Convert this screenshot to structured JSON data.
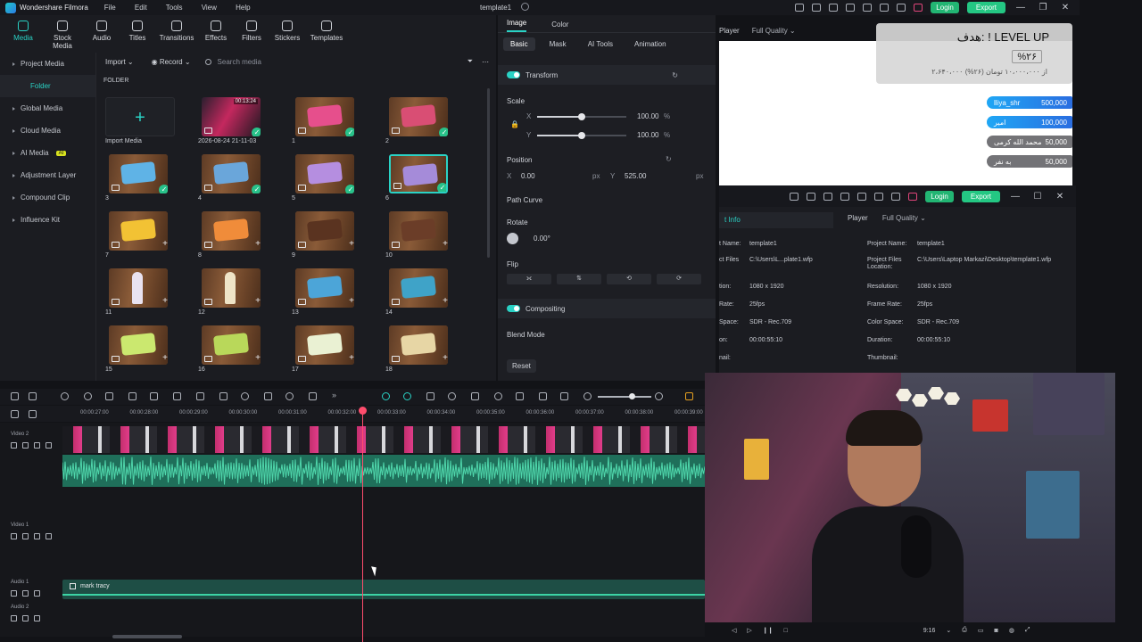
{
  "app": {
    "name": "Wondershare Filmora",
    "document_title": "template1",
    "menu": [
      "File",
      "Edit",
      "Tools",
      "View",
      "Help"
    ],
    "login_label": "Login",
    "export_label": "Export"
  },
  "media_tabs": [
    "Media",
    "Stock Media",
    "Audio",
    "Titles",
    "Transitions",
    "Effects",
    "Filters",
    "Stickers",
    "Templates"
  ],
  "sidebar": {
    "items": [
      {
        "label": "Project Media"
      },
      {
        "label": "Folder"
      },
      {
        "label": "Global Media"
      },
      {
        "label": "Cloud Media"
      },
      {
        "label": "AI Media",
        "badge": "AI"
      },
      {
        "label": "Adjustment Layer"
      },
      {
        "label": "Compound Clip"
      },
      {
        "label": "Influence Kit"
      }
    ]
  },
  "media_toolbar": {
    "import_label": "Import",
    "record_label": "Record",
    "search_placeholder": "Search media"
  },
  "folder_label": "FOLDER",
  "media_items": [
    {
      "label": "Import Media",
      "kind": "import"
    },
    {
      "label": "2026-08-24 21-11-03",
      "kind": "video",
      "duration": "00:13:24"
    },
    {
      "label": "1",
      "kind": "image",
      "color": "#e64f8c"
    },
    {
      "label": "2",
      "kind": "image",
      "color": "#d94e74"
    },
    {
      "label": "3",
      "kind": "image",
      "color": "#5fb3e6"
    },
    {
      "label": "4",
      "kind": "image",
      "color": "#6aa6da"
    },
    {
      "label": "5",
      "kind": "image",
      "color": "#b58ee0"
    },
    {
      "label": "6",
      "kind": "image",
      "color": "#a58bd9"
    },
    {
      "label": "7",
      "kind": "image",
      "color": "#f2c234"
    },
    {
      "label": "8",
      "kind": "image",
      "color": "#f08c3a"
    },
    {
      "label": "9",
      "kind": "image",
      "color": "#5a3320"
    },
    {
      "label": "10",
      "kind": "image",
      "color": "#6b3d28"
    },
    {
      "label": "11",
      "kind": "cone",
      "color": "#e9e2f0"
    },
    {
      "label": "12",
      "kind": "cone",
      "color": "#efe4c7"
    },
    {
      "label": "13",
      "kind": "image",
      "color": "#4ca5d8"
    },
    {
      "label": "14",
      "kind": "image",
      "color": "#3fa3c8"
    },
    {
      "label": "15",
      "kind": "image",
      "color": "#cbe86f"
    },
    {
      "label": "16",
      "kind": "image",
      "color": "#b9d85a"
    },
    {
      "label": "17",
      "kind": "image",
      "color": "#eaf1d3"
    },
    {
      "label": "18",
      "kind": "image",
      "color": "#e7d6a5"
    }
  ],
  "properties": {
    "tabs": [
      "Image",
      "Color"
    ],
    "sub_tabs": [
      "Basic",
      "Mask",
      "AI Tools",
      "Animation"
    ],
    "transform_label": "Transform",
    "scale_label": "Scale",
    "scale_x_label": "X",
    "scale_y_label": "Y",
    "scale_x": "100.00",
    "scale_y": "100.00",
    "scale_unit": "%",
    "scale_x_fraction": 0.5,
    "scale_y_fraction": 0.5,
    "position_label": "Position",
    "pos_x_label": "X",
    "pos_x": "0.00",
    "pos_y_label": "Y",
    "pos_y": "525.00",
    "pos_unit": "px",
    "path_curve_label": "Path Curve",
    "rotate_label": "Rotate",
    "rotate_value": "0.00°",
    "flip_label": "Flip",
    "compositing_label": "Compositing",
    "blend_mode_label": "Blend Mode",
    "reset_label": "Reset"
  },
  "player": {
    "label": "Player",
    "quality": "Full Quality"
  },
  "overlay": {
    "title": "هدف: ! LEVEL UP",
    "percent": "%۲۶",
    "subtitle": "۲،۶۴۰،۰۰۰ از ۱۰،۰۰۰،۰۰۰ تومان (۲۶%)",
    "donors": [
      {
        "name": "lliya_shr",
        "amount": "500,000",
        "style": "b"
      },
      {
        "name": "امیر",
        "amount": "100,000",
        "style": "b"
      },
      {
        "name": "محمد الله کرمی",
        "amount": "50,000",
        "style": "g"
      },
      {
        "name": "به نفر",
        "amount": "50,000",
        "style": "g"
      }
    ]
  },
  "project_info": {
    "tab_label": "t Info",
    "player_label": "Player",
    "quality": "Full Quality",
    "left_rows": [
      {
        "k": "t Name:",
        "v": "template1"
      },
      {
        "k": "ct Files",
        "v": "C:\\Users\\L...plate1.wfp"
      },
      {
        "k": "tion:",
        "v": "1080 x 1920"
      },
      {
        "k": "Rate:",
        "v": "25fps"
      },
      {
        "k": "Space:",
        "v": "SDR - Rec.709"
      },
      {
        "k": "on:",
        "v": "00:00:55:10"
      },
      {
        "k": "nail:",
        "v": ""
      }
    ],
    "right_rows": [
      {
        "k": "Project Name:",
        "v": "template1"
      },
      {
        "k": "Project Files Location:",
        "v": "C:\\Users\\Laptop Markazi\\Desktop\\template1.wfp"
      },
      {
        "k": "Resolution:",
        "v": "1080 x 1920"
      },
      {
        "k": "Frame Rate:",
        "v": "25fps"
      },
      {
        "k": "Color Space:",
        "v": "SDR - Rec.709"
      },
      {
        "k": "Duration:",
        "v": "00:00:55:10"
      },
      {
        "k": "Thumbnail:",
        "v": ""
      }
    ]
  },
  "playback": {
    "ratio": "9:16"
  },
  "timeline": {
    "ticks": [
      "00:00:27:00",
      "00:00:28:00",
      "00:00:29:00",
      "00:00:30:00",
      "00:00:31:00",
      "00:00:32:00",
      "00:00:33:00",
      "00:00:34:00",
      "00:00:35:00",
      "00:00:36:00",
      "00:00:37:00",
      "00:00:38:00",
      "00:00:39:00"
    ],
    "tracks": [
      "Video 2",
      "Video 1",
      "Audio 1",
      "Audio 2"
    ],
    "audio_clip_label": "mark tracy"
  }
}
